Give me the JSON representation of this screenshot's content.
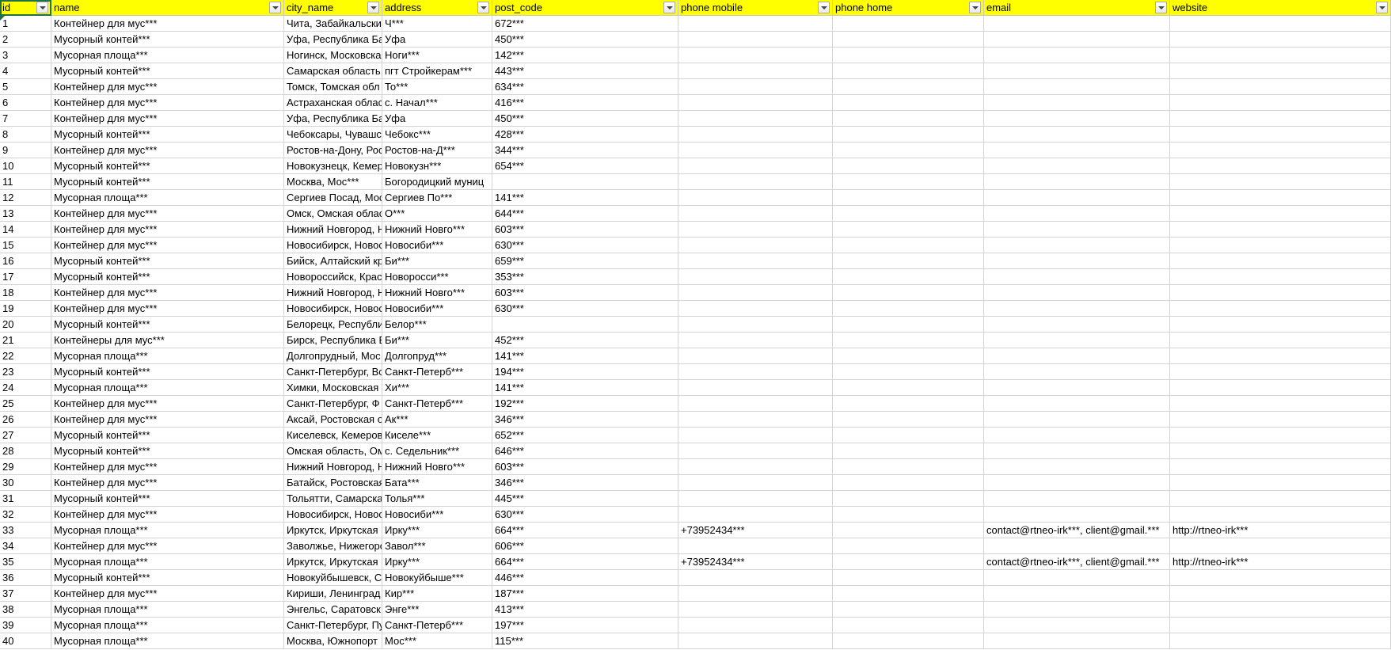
{
  "headers": [
    "id",
    "name",
    "city_name",
    "address",
    "post_code",
    "phone mobile",
    "phone home",
    "email",
    "website"
  ],
  "rows": [
    [
      "1",
      "Контейнер для мус***",
      "Чита, Забайкальский",
      "Ч***",
      "672***",
      "",
      "",
      "",
      ""
    ],
    [
      "2",
      "Мусорный контей***",
      "Уфа, Республика Баш",
      "Уфа",
      "450***",
      "",
      "",
      "",
      ""
    ],
    [
      "3",
      "Мусорная площа***",
      "Ногинск, Московская",
      "Ноги***",
      "142***",
      "",
      "",
      "",
      ""
    ],
    [
      "4",
      "Мусорный контей***",
      "Самарская область,",
      "пгт Стройкерам***",
      "443***",
      "",
      "",
      "",
      ""
    ],
    [
      "5",
      "Контейнер для мус***",
      "Томск, Томская обл",
      "То***",
      "634***",
      "",
      "",
      "",
      ""
    ],
    [
      "6",
      "Контейнер для мус***",
      "Астраханская облас",
      "с. Начал***",
      "416***",
      "",
      "",
      "",
      ""
    ],
    [
      "7",
      "Контейнер для мус***",
      "Уфа, Республика Баш",
      "Уфа",
      "450***",
      "",
      "",
      "",
      ""
    ],
    [
      "8",
      "Мусорный контей***",
      "Чебоксары, Чувашск",
      "Чебокс***",
      "428***",
      "",
      "",
      "",
      ""
    ],
    [
      "9",
      "Контейнер для мус***",
      "Ростов-на-Дону, Рос",
      "Ростов-на-Д***",
      "344***",
      "",
      "",
      "",
      ""
    ],
    [
      "10",
      "Мусорный контей***",
      "Новокузнецк, Кемер",
      "Новокузн***",
      "654***",
      "",
      "",
      "",
      ""
    ],
    [
      "11",
      "Мусорный контей***",
      "Москва, Мос***",
      "Богородицкий муниц",
      "",
      "",
      "",
      "",
      ""
    ],
    [
      "12",
      "Мусорная площа***",
      "Сергиев Посад, Мос",
      "Сергиев По***",
      "141***",
      "",
      "",
      "",
      ""
    ],
    [
      "13",
      "Контейнер для мус***",
      "Омск, Омская облас",
      "О***",
      "644***",
      "",
      "",
      "",
      ""
    ],
    [
      "14",
      "Контейнер для мус***",
      "Нижний Новгород, Н",
      "Нижний Новго***",
      "603***",
      "",
      "",
      "",
      ""
    ],
    [
      "15",
      "Контейнер для мус***",
      "Новосибирск, Новос",
      "Новосиби***",
      "630***",
      "",
      "",
      "",
      ""
    ],
    [
      "16",
      "Мусорный контей***",
      "Бийск, Алтайский кр",
      "Би***",
      "659***",
      "",
      "",
      "",
      ""
    ],
    [
      "17",
      "Мусорный контей***",
      "Новороссийск, Крас",
      "Новоросси***",
      "353***",
      "",
      "",
      "",
      ""
    ],
    [
      "18",
      "Контейнер для мус***",
      "Нижний Новгород, Н",
      "Нижний Новго***",
      "603***",
      "",
      "",
      "",
      ""
    ],
    [
      "19",
      "Контейнер для мус***",
      "Новосибирск, Новос",
      "Новосиби***",
      "630***",
      "",
      "",
      "",
      ""
    ],
    [
      "20",
      "Мусорный контей***",
      "Белорецк, Республи",
      "Белор***",
      "",
      "",
      "",
      "",
      ""
    ],
    [
      "21",
      "Контейнеры для мус***",
      "Бирск, Республика Б",
      "Би***",
      "452***",
      "",
      "",
      "",
      ""
    ],
    [
      "22",
      "Мусорная площа***",
      "Долгопрудный, Мос",
      "Долгопруд***",
      "141***",
      "",
      "",
      "",
      ""
    ],
    [
      "23",
      "Мусорный контей***",
      "Санкт-Петербург, Во",
      "Санкт-Петерб***",
      "194***",
      "",
      "",
      "",
      ""
    ],
    [
      "24",
      "Мусорная площа***",
      "Химки, Московская о",
      "Хи***",
      "141***",
      "",
      "",
      "",
      ""
    ],
    [
      "25",
      "Контейнер для мус***",
      "Санкт-Петербург, Ф",
      "Санкт-Петерб***",
      "192***",
      "",
      "",
      "",
      ""
    ],
    [
      "26",
      "Контейнер для мус***",
      "Аксай, Ростовская о",
      "Ак***",
      "346***",
      "",
      "",
      "",
      ""
    ],
    [
      "27",
      "Мусорный контей***",
      "Киселевск, Кемеров",
      "Киселе***",
      "652***",
      "",
      "",
      "",
      ""
    ],
    [
      "28",
      "Мусорный контей***",
      "Омская область, Ом",
      "с. Седельник***",
      "646***",
      "",
      "",
      "",
      ""
    ],
    [
      "29",
      "Контейнер для мус***",
      "Нижний Новгород, Н",
      "Нижний Новго***",
      "603***",
      "",
      "",
      "",
      ""
    ],
    [
      "30",
      "Контейнер для мус***",
      "Батайск, Ростовская",
      "Бата***",
      "346***",
      "",
      "",
      "",
      ""
    ],
    [
      "31",
      "Мусорный контей***",
      "Тольятти, Самарска",
      "Толья***",
      "445***",
      "",
      "",
      "",
      ""
    ],
    [
      "32",
      "Контейнер для мус***",
      "Новосибирск, Новос",
      "Новосиби***",
      "630***",
      "",
      "",
      "",
      ""
    ],
    [
      "33",
      "Мусорная площа***",
      "Иркутск, Иркутская",
      "Ирку***",
      "664***",
      "+73952434***",
      "",
      "contact@rtneo-irk***, client@gmail.***",
      "http://rtneo-irk***"
    ],
    [
      "34",
      "Контейнер для мус***",
      "Заволжье, Нижегоро",
      "Завол***",
      "606***",
      "",
      "",
      "",
      ""
    ],
    [
      "35",
      "Мусорная площа***",
      "Иркутск, Иркутская",
      "Ирку***",
      "664***",
      "+73952434***",
      "",
      "contact@rtneo-irk***, client@gmail.***",
      "http://rtneo-irk***"
    ],
    [
      "36",
      "Мусорный контей***",
      "Новокуйбышевск, С",
      "Новокуйбыше***",
      "446***",
      "",
      "",
      "",
      ""
    ],
    [
      "37",
      "Контейнер для мус***",
      "Кириши, Ленинград",
      "Кир***",
      "187***",
      "",
      "",
      "",
      ""
    ],
    [
      "38",
      "Мусорная площа***",
      "Энгельс, Саратовск",
      "Энге***",
      "413***",
      "",
      "",
      "",
      ""
    ],
    [
      "39",
      "Мусорная площа***",
      "Санкт-Петербург, Пу",
      "Санкт-Петерб***",
      "197***",
      "",
      "",
      "",
      ""
    ],
    [
      "40",
      "Мусорная площа***",
      "Москва, Южнопорт",
      "Мос***",
      "115***",
      "",
      "",
      "",
      ""
    ]
  ],
  "colors": {
    "header_fill": "#ffff00",
    "gridline": "#d4d4d4",
    "selection": "#1e7145"
  },
  "icons": {
    "filter": "filter-dropdown-icon",
    "error": "error-indicator-icon"
  }
}
